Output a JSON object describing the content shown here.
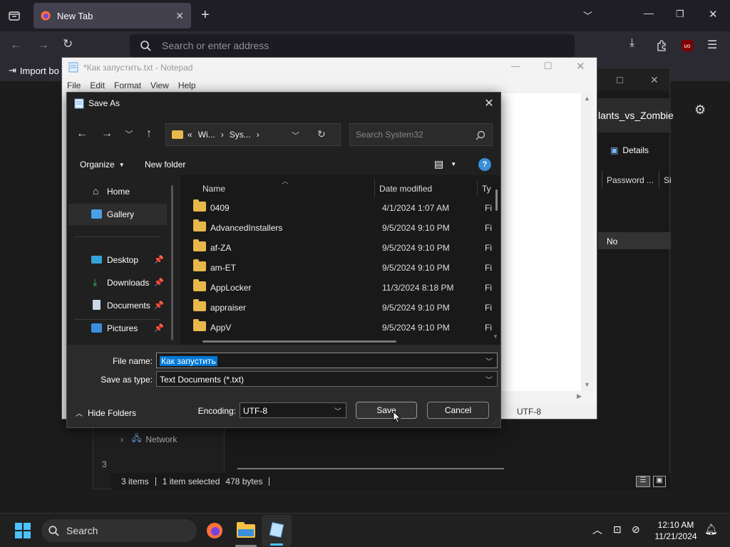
{
  "browser": {
    "tab_title": "New Tab",
    "address_placeholder": "Search or enter address",
    "bookmark_import": "Import bo",
    "ublock_badge": "uo"
  },
  "background_explorer": {
    "tab_title_partial": "lants_vs_Zombie",
    "details_label": "Details",
    "column_password": "Password ...",
    "column_size_partial": "Si",
    "row_value": "No",
    "nav_network": "Network",
    "left_partial_count": "3",
    "status": {
      "items": "3 items",
      "selected": "1 item selected",
      "size": "478 bytes"
    }
  },
  "notepad": {
    "title": "*Как запустить.txt - Notepad",
    "menu": [
      "File",
      "Edit",
      "Format",
      "View",
      "Help"
    ],
    "encoding_status": "UTF-8"
  },
  "dialog": {
    "title": "Save As",
    "breadcrumb": {
      "prefix": "«",
      "seg1": "Wi...",
      "seg2": "Sys..."
    },
    "search_placeholder": "Search System32",
    "organize_label": "Organize",
    "new_folder_label": "New folder",
    "nav_items": [
      {
        "label": "Home",
        "pinned": false
      },
      {
        "label": "Gallery",
        "pinned": false
      },
      {
        "label": "Desktop",
        "pinned": true
      },
      {
        "label": "Downloads",
        "pinned": true
      },
      {
        "label": "Documents",
        "pinned": true
      },
      {
        "label": "Pictures",
        "pinned": true
      }
    ],
    "columns": {
      "name": "Name",
      "date": "Date modified",
      "type": "Ty"
    },
    "files": [
      {
        "name": "0409",
        "date": "4/1/2024 1:07 AM",
        "type": "Fi"
      },
      {
        "name": "AdvancedInstallers",
        "date": "9/5/2024 9:10 PM",
        "type": "Fi"
      },
      {
        "name": "af-ZA",
        "date": "9/5/2024 9:10 PM",
        "type": "Fi"
      },
      {
        "name": "am-ET",
        "date": "9/5/2024 9:10 PM",
        "type": "Fi"
      },
      {
        "name": "AppLocker",
        "date": "11/3/2024 8:18 PM",
        "type": "Fi"
      },
      {
        "name": "appraiser",
        "date": "9/5/2024 9:10 PM",
        "type": "Fi"
      },
      {
        "name": "AppV",
        "date": "9/5/2024 9:10 PM",
        "type": "Fi"
      }
    ],
    "file_name_label": "File name:",
    "file_name_value": "Как запустить",
    "save_type_label": "Save as type:",
    "save_type_value": "Text Documents (*.txt)",
    "hide_folders_label": "Hide Folders",
    "encoding_label": "Encoding:",
    "encoding_value": "UTF-8",
    "save_label": "Save",
    "cancel_label": "Cancel"
  },
  "taskbar": {
    "search_label": "Search",
    "time": "12:10 AM",
    "date": "11/21/2024"
  },
  "colors": {
    "accent": "#0078d4",
    "folder": "#e8b84a",
    "dialog_bg": "#202020"
  }
}
